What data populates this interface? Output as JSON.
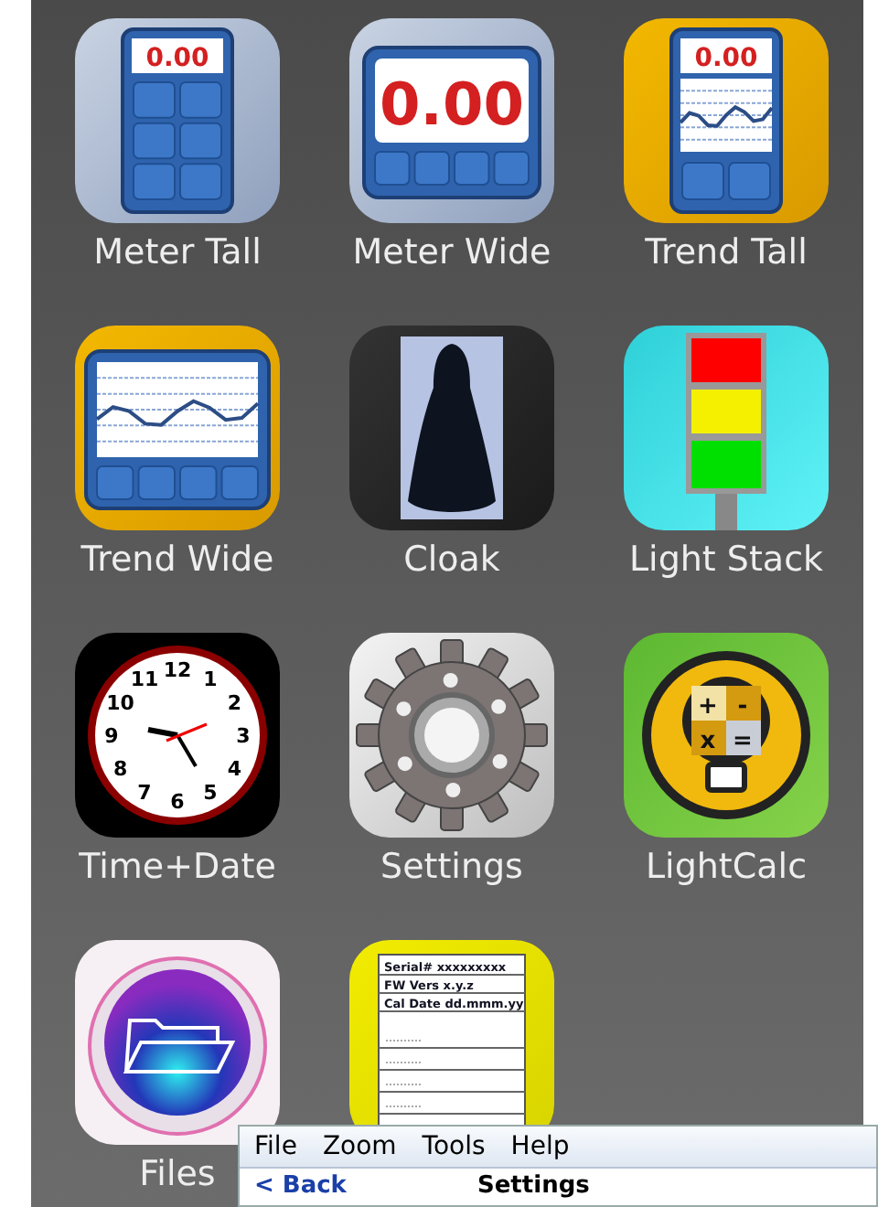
{
  "apps": [
    {
      "kind": "meter_tall",
      "label": "Meter Tall",
      "reading": "0.00"
    },
    {
      "kind": "meter_wide",
      "label": "Meter Wide",
      "reading": "0.00"
    },
    {
      "kind": "trend_tall",
      "label": "Trend Tall",
      "reading": "0.00"
    },
    {
      "kind": "trend_wide",
      "label": "Trend Wide"
    },
    {
      "kind": "cloak",
      "label": "Cloak"
    },
    {
      "kind": "light_stack",
      "label": "Light Stack"
    },
    {
      "kind": "clock",
      "label": "Time+Date",
      "numerals": [
        "11",
        "12",
        "1",
        "10",
        "2",
        "9",
        "3",
        "8",
        "4",
        "7",
        "6",
        "5"
      ]
    },
    {
      "kind": "settings",
      "label": "Settings"
    },
    {
      "kind": "lightcalc",
      "label": "LightCalc",
      "symbols": [
        "+",
        "-",
        "x",
        "="
      ]
    },
    {
      "kind": "files",
      "label": "Files"
    },
    {
      "kind": "document",
      "lines": [
        "Serial# xxxxxxxxx",
        "FW Vers x.y.z",
        "Cal Date dd.mmm.yy"
      ]
    }
  ],
  "window": {
    "menu": [
      "File",
      "Zoom",
      "Tools",
      "Help"
    ],
    "back": "< Back",
    "title": "Settings"
  }
}
